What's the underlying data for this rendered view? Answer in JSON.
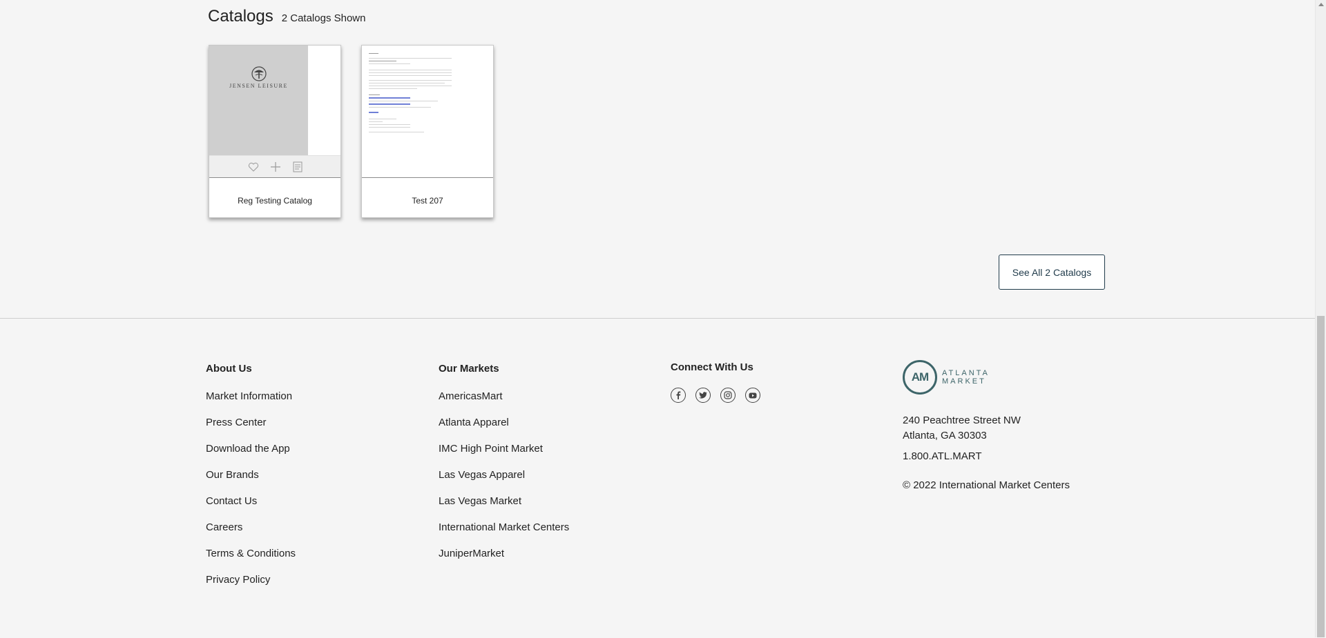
{
  "catalogs": {
    "title": "Catalogs",
    "count_text": "2 Catalogs Shown",
    "items": [
      {
        "label": "Reg Testing Catalog",
        "brand_text": "JENSEN LEISURE"
      },
      {
        "label": "Test 207"
      }
    ],
    "see_all_label": "See All 2 Catalogs"
  },
  "footer": {
    "about": {
      "heading": "About Us",
      "links": [
        "Market Information",
        "Press Center",
        "Download the App",
        "Our Brands",
        "Contact Us",
        "Careers",
        "Terms & Conditions",
        "Privacy Policy"
      ]
    },
    "markets": {
      "heading": "Our Markets",
      "links": [
        "AmericasMart",
        "Atlanta Apparel",
        "IMC High Point Market",
        "Las Vegas Apparel",
        "Las Vegas Market",
        "International Market Centers",
        "JuniperMarket"
      ]
    },
    "connect": {
      "heading": "Connect With Us",
      "icons": [
        "facebook-icon",
        "twitter-icon",
        "instagram-icon",
        "youtube-icon"
      ]
    },
    "contact": {
      "logo_mark": "AM",
      "logo_line1": "ATLANTA",
      "logo_line2": "MARKET",
      "address_line1": "240 Peachtree Street NW",
      "address_line2": "Atlanta, GA 30303",
      "phone": "1.800.ATL.MART",
      "copyright": "© 2022 International Market Centers"
    }
  },
  "colors": {
    "brand": "#3d6569",
    "button_border": "#1f3a4a",
    "background": "#f5f5f5"
  }
}
